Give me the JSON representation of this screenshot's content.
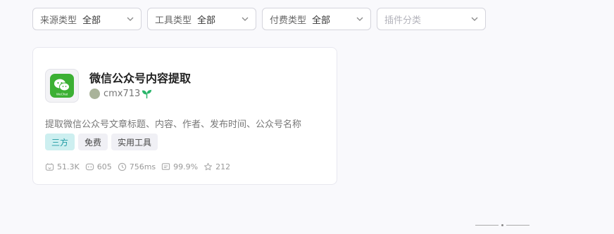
{
  "filters": [
    {
      "label": "来源类型",
      "value": "全部"
    },
    {
      "label": "工具类型",
      "value": "全部"
    },
    {
      "label": "付费类型",
      "value": "全部"
    },
    {
      "placeholder": "插件分类"
    }
  ],
  "card": {
    "logo_text": "WeChat",
    "title": "微信公众号内容提取",
    "author": "cmx713",
    "description": "提取微信公众号文章标题、内容、作者、发布时间、公众号名称",
    "tags": [
      "三方",
      "免费",
      "实用工具"
    ],
    "stats": {
      "installs": "51.3K",
      "calls": "605",
      "latency": "756ms",
      "success_rate": "99.9%",
      "stars": "212"
    }
  },
  "colors": {
    "accent_tag_bg": "#cdeff0",
    "accent_tag_text": "#1e9aa3",
    "wechat_green": "#3cb034"
  }
}
